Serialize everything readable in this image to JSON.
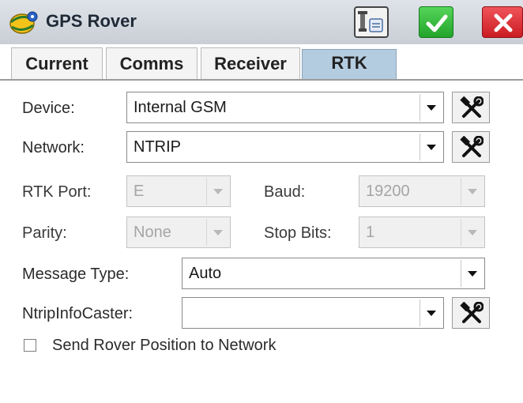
{
  "titlebar": {
    "title": "GPS Rover",
    "icons": {
      "logo": "gps-rover-logo",
      "settings": "receiver-settings-icon",
      "ok": "checkmark-icon",
      "cancel": "close-icon"
    },
    "colors": {
      "ok": "#22a32a",
      "cancel": "#c91c22",
      "bar": "#cfd4db"
    }
  },
  "tabs": [
    {
      "label": "Current",
      "active": false
    },
    {
      "label": "Comms",
      "active": false
    },
    {
      "label": "Receiver",
      "active": false
    },
    {
      "label": "RTK",
      "active": true
    }
  ],
  "form": {
    "device": {
      "label": "Device:",
      "value": "Internal GSM"
    },
    "network": {
      "label": "Network:",
      "value": "NTRIP"
    },
    "rtk_port": {
      "label": "RTK Port:",
      "value": "E",
      "enabled": false
    },
    "baud": {
      "label": "Baud:",
      "value": "19200",
      "enabled": false
    },
    "parity": {
      "label": "Parity:",
      "value": "None",
      "enabled": false
    },
    "stop_bits": {
      "label": "Stop Bits:",
      "value": "1",
      "enabled": false
    },
    "message_type": {
      "label": "Message Type:",
      "value": "Auto"
    },
    "ntrip_info_caster": {
      "label": "NtripInfoCaster:",
      "value": ""
    },
    "send_position": {
      "label": "Send Rover Position to Network",
      "checked": false
    },
    "tool_icon": "tools-icon"
  }
}
